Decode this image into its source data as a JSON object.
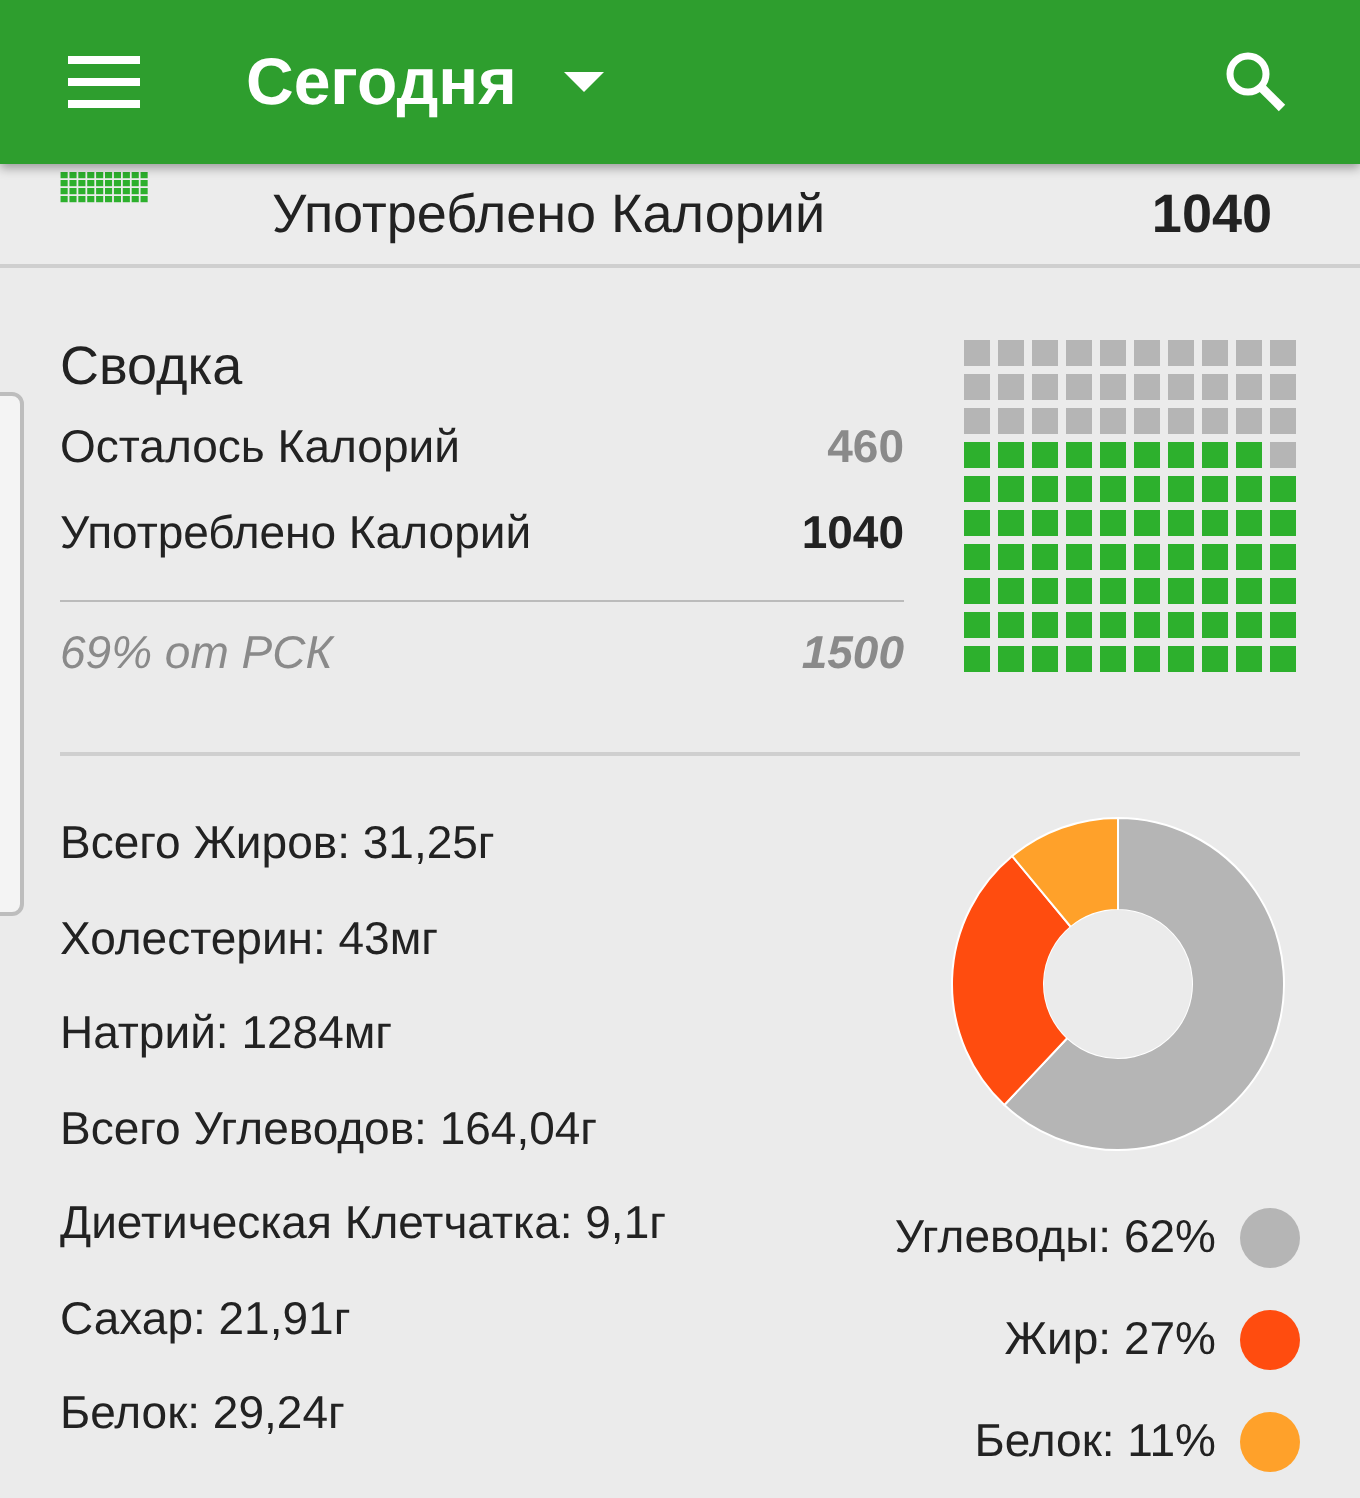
{
  "app_bar": {
    "title": "Сегодня"
  },
  "consumed_row": {
    "label": "Употреблено Калорий",
    "value": "1040"
  },
  "summary": {
    "title": "Сводка",
    "rows": [
      {
        "label": "Осталось Калорий",
        "value": "460",
        "kind": "muted"
      },
      {
        "label": "Употреблено Калорий",
        "value": "1040",
        "kind": "bold"
      }
    ],
    "goal": {
      "label": "69% от РСК",
      "value": "1500"
    }
  },
  "nutrients": [
    "Всего Жиров: 31,25г",
    "Холестерин: 43мг",
    "Натрий: 1284мг",
    "Всего Углеводов: 164,04г",
    "Диетическая Клетчатка: 9,1г",
    "Сахар: 21,91г",
    "Белок: 29,24г"
  ],
  "macros": {
    "chart_data": {
      "type": "donut",
      "categories": [
        "Углеводы: 62%",
        "Жир: 27%",
        "Белок: 11%"
      ],
      "values": [
        62,
        27,
        11
      ]
    },
    "legend": [
      {
        "color": "#b5b5b5"
      },
      {
        "color": "#ff4c0f"
      },
      {
        "color": "#ffa12a"
      }
    ]
  }
}
